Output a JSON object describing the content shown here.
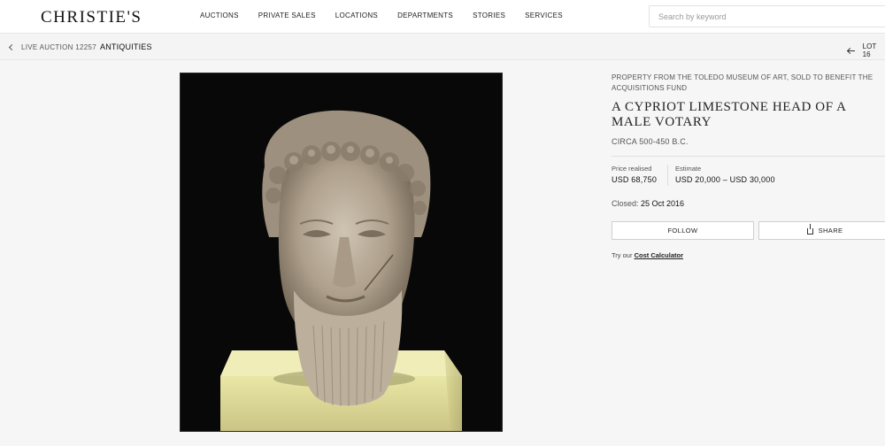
{
  "header": {
    "logo": "CHRISTIE'S",
    "nav": [
      "AUCTIONS",
      "PRIVATE SALES",
      "LOCATIONS",
      "DEPARTMENTS",
      "STORIES",
      "SERVICES"
    ],
    "search_placeholder": "Search by keyword"
  },
  "breadcrumb": {
    "sale": "LIVE AUCTION 12257",
    "department": "ANTIQUITIES",
    "lot_label": "LOT 16"
  },
  "lot": {
    "provenance": "PROPERTY FROM THE TOLEDO MUSEUM OF ART, SOLD TO BENEFIT THE ACQUISITIONS FUND",
    "title": "A CYPRIOT LIMESTONE HEAD OF A MALE VOTARY",
    "circa": "CIRCA 500-450 B.C.",
    "price_label": "Price realised",
    "price_value": "USD 68,750",
    "estimate_label": "Estimate",
    "estimate_value": "USD 20,000 – USD 30,000",
    "closed_label": "Closed:",
    "closed_date": "25 Oct 2016",
    "follow_label": "FOLLOW",
    "share_label": "SHARE",
    "calc_prefix": "Try our",
    "calc_link": "Cost Calculator"
  },
  "image": {
    "subject": "limestone-head-photo"
  }
}
